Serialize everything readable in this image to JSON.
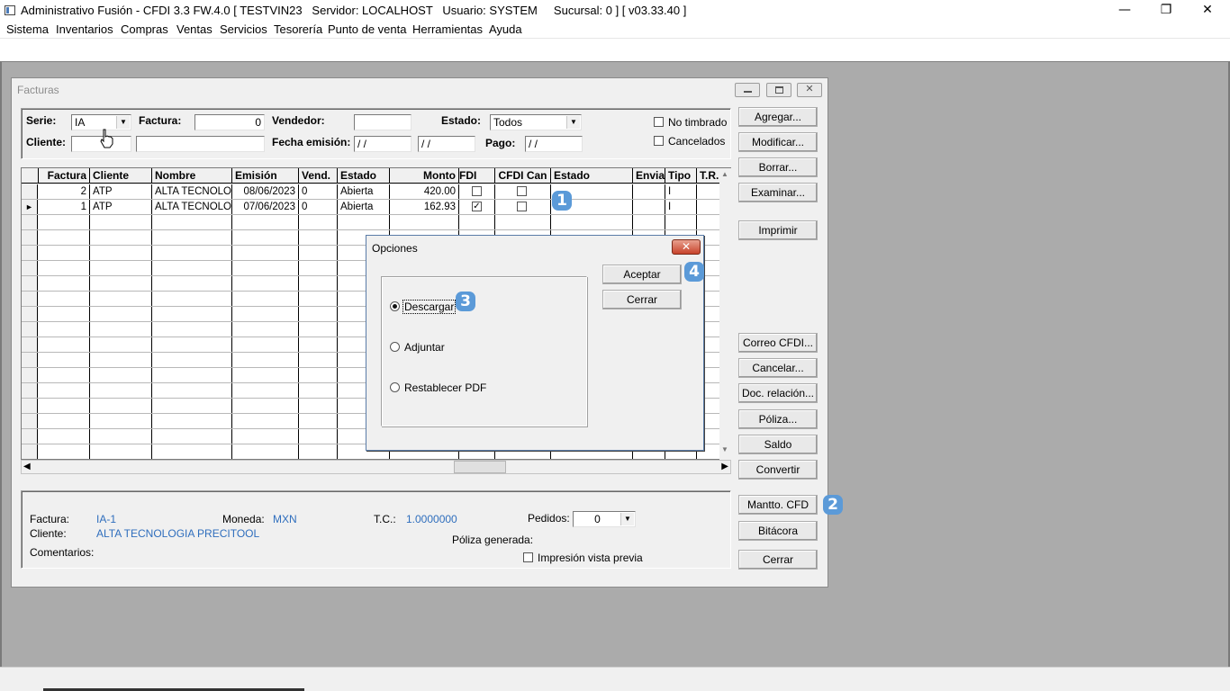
{
  "app": {
    "title": "Administrativo Fusión - CFDI 3.3 FW.4.0 [ TESTVIN23   Servidor: LOCALHOST   Usuario: SYSTEM     Sucursal: 0 ] [ v03.33.40 ]",
    "window_controls": {
      "minimize": "—",
      "restore": "❐",
      "close": "✕"
    }
  },
  "menu": [
    "Sistema",
    "Inventarios",
    "Compras",
    "Ventas",
    "Servicios",
    "Tesorería",
    "Punto de venta",
    "Herramientas",
    "Ayuda"
  ],
  "facturas": {
    "title": "Facturas",
    "filters": {
      "serie_label": "Serie:",
      "serie_value": "IA",
      "factura_label": "Factura:",
      "factura_value": "0",
      "vendedor_label": "Vendedor:",
      "vendedor_value": "",
      "estado_label": "Estado:",
      "estado_value": "Todos",
      "cliente_label": "Cliente:",
      "cliente_value": "",
      "cliente_name": "",
      "fecha_label": "Fecha emisión:",
      "fecha_desde": " / /",
      "fecha_hasta": "  / /",
      "pago_label": "Pago:",
      "pago_value": " / /",
      "no_timbrado": "No timbrado",
      "cancelados": "Cancelados"
    },
    "grid": {
      "headers": [
        "Factura",
        "Cliente",
        "Nombre",
        "Emisión",
        "Vend.",
        "Estado",
        "Monto",
        "FDI",
        "CFDI Can",
        "Estado",
        "Envia",
        "Tipo",
        "T.R."
      ],
      "rows": [
        {
          "factura": "2",
          "cliente": "ATP",
          "nombre": "ALTA TECNOLOG",
          "emision": "08/06/2023",
          "vend": "0",
          "estado": "Abierta",
          "monto": "420.00",
          "cfdi": "",
          "cfdi_can": "",
          "tipo": "I",
          "current": ""
        },
        {
          "factura": "1",
          "cliente": "ATP",
          "nombre": "ALTA TECNOLOG",
          "emision": "07/06/2023",
          "vend": "0",
          "estado": "Abierta",
          "monto": "162.93",
          "cfdi": "✓",
          "cfdi_can": "",
          "tipo": "I",
          "current": "►"
        }
      ]
    },
    "buttons": {
      "agregar": "Agregar...",
      "modificar": "Modificar...",
      "borrar": "Borrar...",
      "examinar": "Examinar...",
      "imprimir": "Imprimir",
      "correo": "Correo CFDI...",
      "cancelar": "Cancelar...",
      "doc_relacion": "Doc. relación...",
      "poliza": "Póliza...",
      "saldo": "Saldo",
      "convertir": "Convertir",
      "mantto": "Mantto. CFD",
      "bitacora": "Bitácora",
      "cerrar": "Cerrar"
    },
    "detail": {
      "factura_label": "Factura:",
      "factura_value": "IA-1",
      "moneda_label": "Moneda:",
      "moneda_value": "MXN",
      "tc_label": "T.C.:",
      "tc_value": "1.0000000",
      "pedidos_label": "Pedidos:",
      "pedidos_value": "0",
      "cliente_label": "Cliente:",
      "cliente_value": "ALTA TECNOLOGIA PRECITOOL",
      "poliza_label": "Póliza generada:",
      "comentarios_label": "Comentarios:",
      "impresion_label": "Impresión vista previa"
    }
  },
  "opciones": {
    "title": "Opciones",
    "close": "✕",
    "options": [
      "Descargar",
      "Adjuntar",
      "Restablecer PDF"
    ],
    "selected": "Descargar",
    "aceptar": "Aceptar",
    "cerrar": "Cerrar"
  },
  "callouts": [
    "1",
    "2",
    "3",
    "4"
  ],
  "colors": {
    "accent": "#5b9ad8",
    "value_text": "#2f6ebd",
    "mdi_background": "#ababab"
  }
}
